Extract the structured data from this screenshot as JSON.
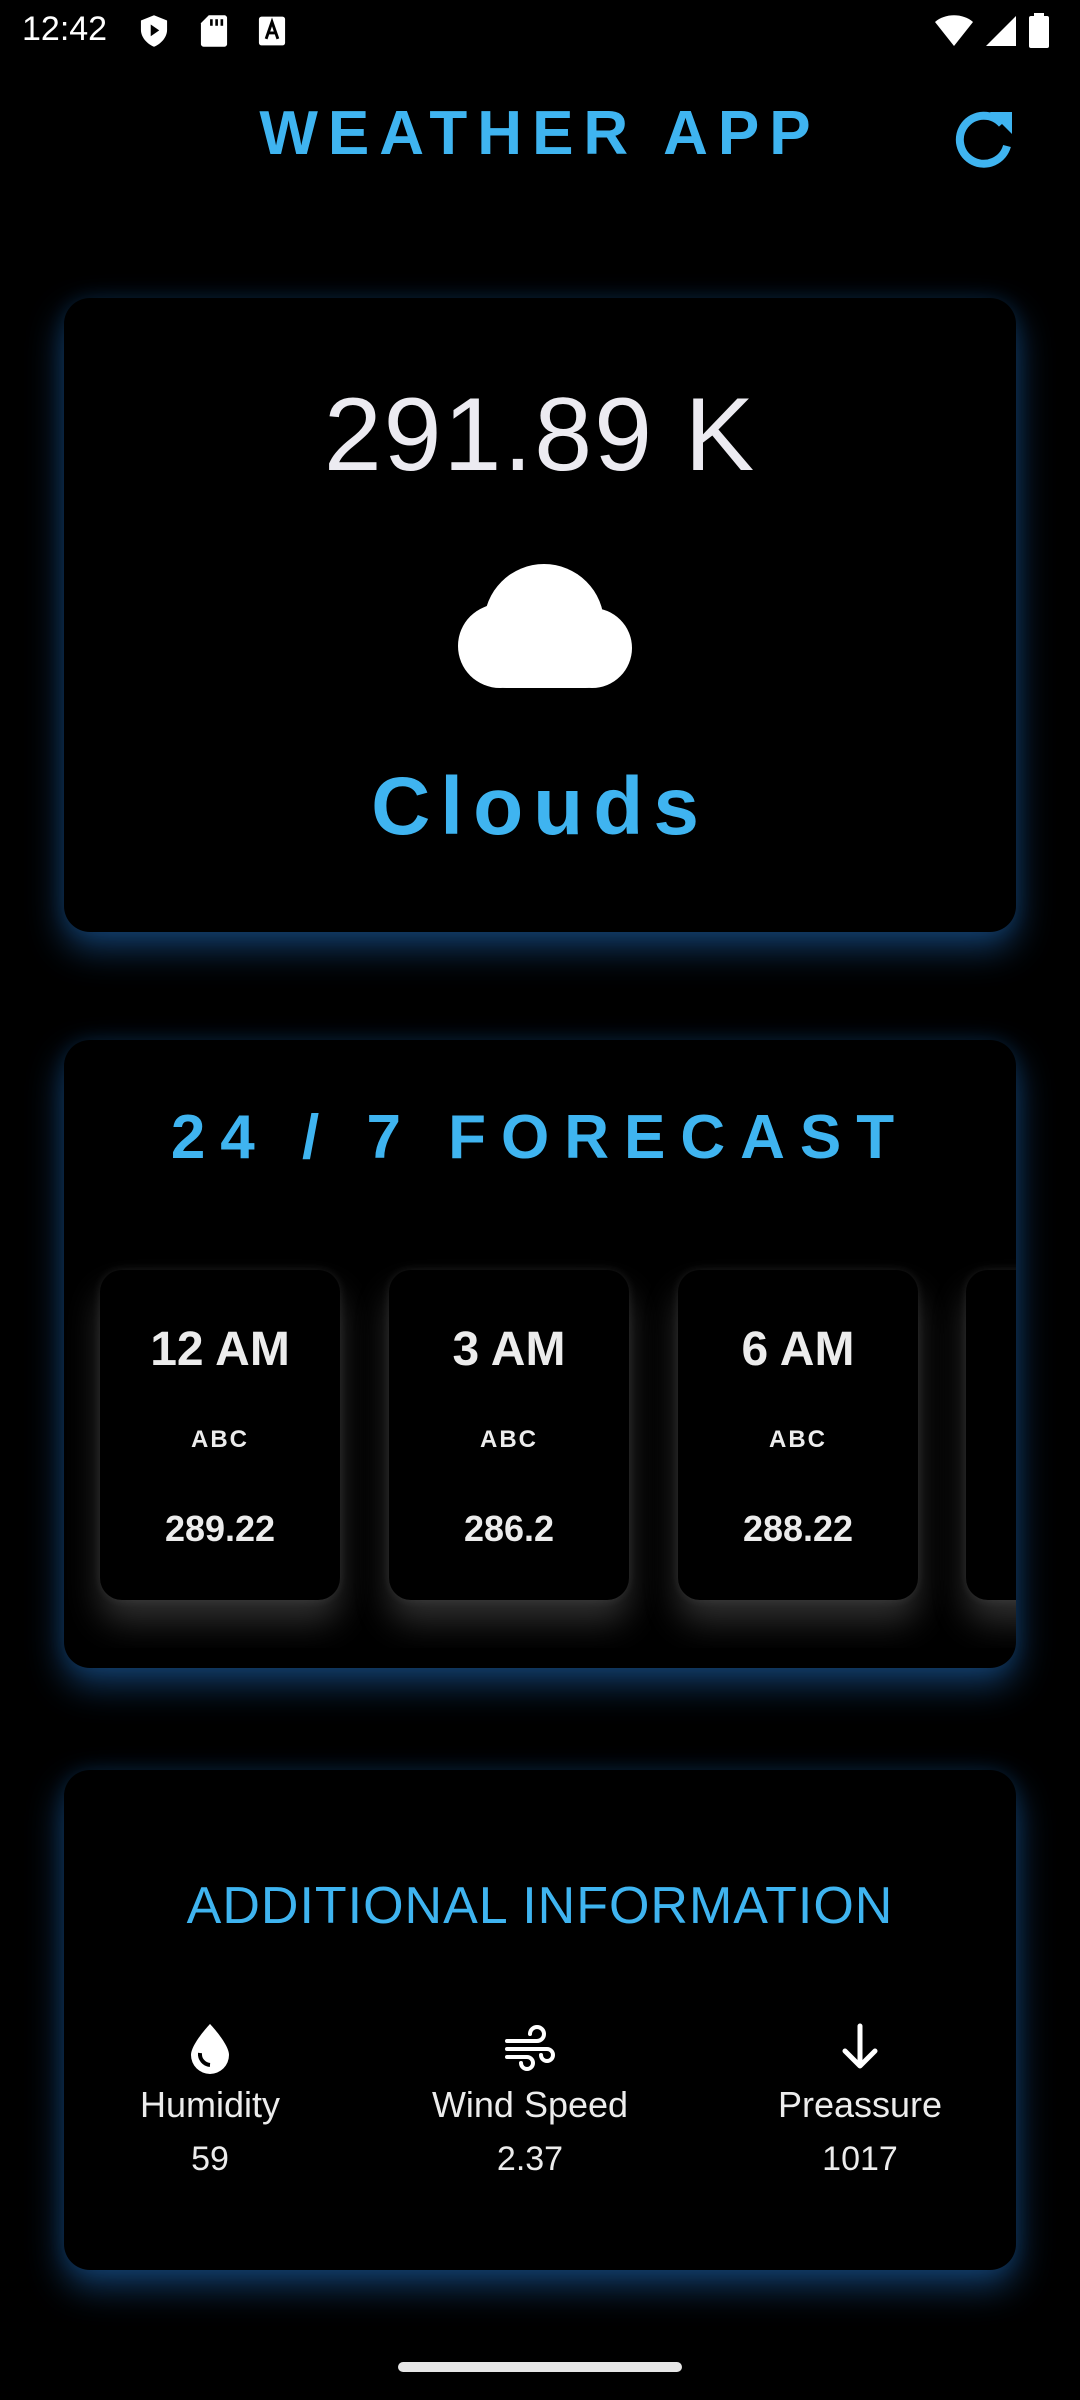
{
  "status_bar": {
    "time": "12:42",
    "left_icons": [
      "shield-play-icon",
      "sd-card-icon",
      "keyboard-a-icon"
    ],
    "right_icons": [
      "wifi-icon",
      "cellular-signal-icon",
      "battery-icon"
    ]
  },
  "header": {
    "title": "WEATHER APP",
    "refresh_icon": "refresh-icon"
  },
  "current": {
    "temperature": "291.89 K",
    "condition_icon": "cloud-icon",
    "condition": "Clouds"
  },
  "forecast": {
    "title": "24 / 7 FORECAST",
    "items": [
      {
        "time": "12 AM",
        "icon_text": "ABC",
        "temp": "289.22"
      },
      {
        "time": "3 AM",
        "icon_text": "ABC",
        "temp": "286.2"
      },
      {
        "time": "6 AM",
        "icon_text": "ABC",
        "temp": "288.22"
      }
    ]
  },
  "additional": {
    "title": "ADDITIONAL INFORMATION",
    "items": [
      {
        "icon": "water-drop-icon",
        "label": "Humidity",
        "value": "59"
      },
      {
        "icon": "wind-icon",
        "label": "Wind Speed",
        "value": "2.37"
      },
      {
        "icon": "arrow-down-icon",
        "label": "Preassure",
        "value": "1017"
      }
    ]
  },
  "colors": {
    "accent": "#3fb4f0",
    "background": "#000000",
    "text": "#ececec"
  }
}
